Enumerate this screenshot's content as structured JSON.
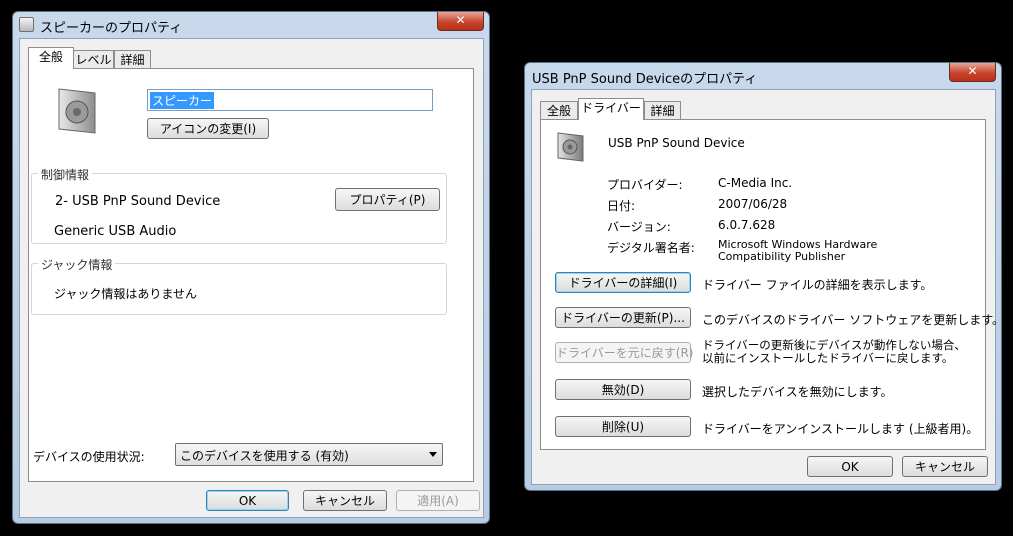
{
  "left_window": {
    "title": "スピーカーのプロパティ",
    "close_label": "✕",
    "tabs": [
      "全般",
      "レベル",
      "詳細"
    ],
    "name_value": "スピーカー",
    "change_icon_button": "アイコンの変更(I)",
    "controller_group": "制御情報",
    "device_line": "2- USB PnP Sound Device",
    "properties_button": "プロパティ(P)",
    "generic_line": "Generic USB Audio",
    "jack_group": "ジャック情報",
    "jack_text": "ジャック情報はありません",
    "usage_label": "デバイスの使用状況:",
    "usage_value": "このデバイスを使用する (有効)",
    "ok": "OK",
    "cancel": "キャンセル",
    "apply": "適用(A)"
  },
  "right_window": {
    "title": "USB PnP Sound Deviceのプロパティ",
    "close_label": "✕",
    "tabs": [
      "全般",
      "ドライバー",
      "詳細"
    ],
    "device_name": "USB PnP Sound Device",
    "info": [
      {
        "label": "プロバイダー:",
        "value": "C-Media Inc."
      },
      {
        "label": "日付:",
        "value": "2007/06/28"
      },
      {
        "label": "バージョン:",
        "value": "6.0.7.628"
      },
      {
        "label": "デジタル署名者:",
        "value": "Microsoft Windows Hardware Compatibility Publisher"
      }
    ],
    "actions": [
      {
        "button": "ドライバーの詳細(I)",
        "desc": "ドライバー ファイルの詳細を表示します。"
      },
      {
        "button": "ドライバーの更新(P)...",
        "desc": "このデバイスのドライバー ソフトウェアを更新します。"
      },
      {
        "button": "ドライバーを元に戻す(R)",
        "desc": "ドライバーの更新後にデバイスが動作しない場合、以前にインストールしたドライバーに戻します。"
      },
      {
        "button": "無効(D)",
        "desc": "選択したデバイスを無効にします。"
      },
      {
        "button": "削除(U)",
        "desc": "ドライバーをアンインストールします (上級者用)。"
      }
    ],
    "ok": "OK",
    "cancel": "キャンセル"
  }
}
